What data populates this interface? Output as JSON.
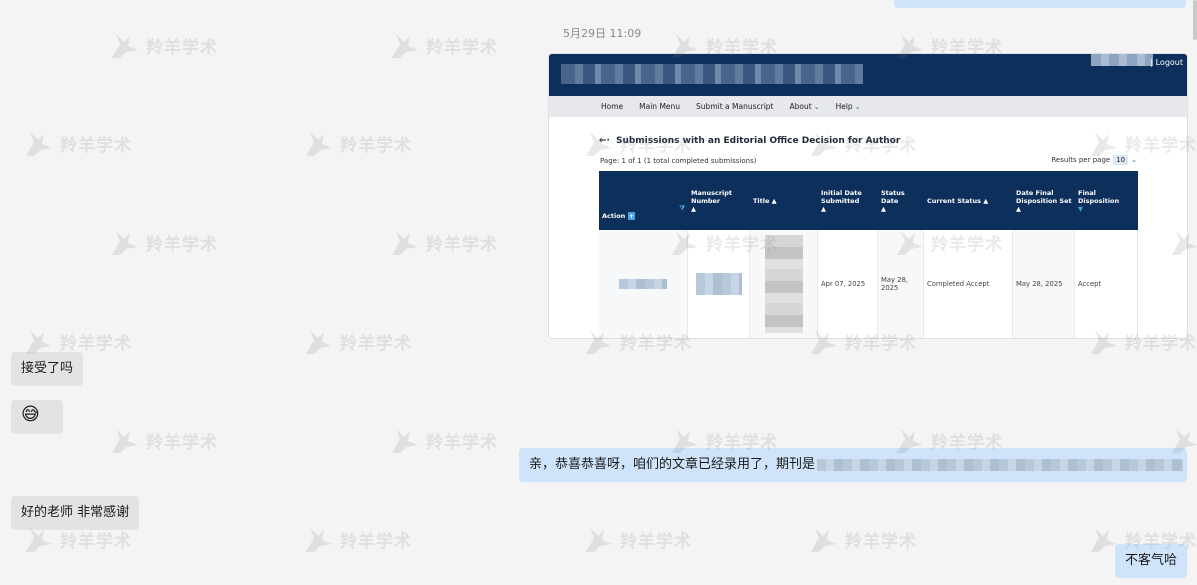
{
  "chat": {
    "timestamp": "5月29日 11:09",
    "messages": [
      {
        "side": "in",
        "text": "接受了吗"
      },
      {
        "side": "in",
        "emoji": "😅"
      },
      {
        "side": "out",
        "text": "亲，恭喜恭喜呀，咱们的文章已经录用了，期刊是"
      },
      {
        "side": "in",
        "text": "好的老师  非常感谢"
      },
      {
        "side": "out",
        "text": "不客气哈"
      }
    ]
  },
  "watermark": {
    "text": "羚羊学术"
  },
  "screenshot": {
    "logout": "Logout",
    "nav": [
      "Home",
      "Main Menu",
      "Submit a Manuscript",
      "About",
      "Help"
    ],
    "title": "Submissions with an Editorial Office Decision for Author",
    "page_info": "Page: 1 of 1 (1 total completed submissions)",
    "results_per_page_label": "Results per page",
    "results_per_page_value": "10",
    "columns": [
      "Action",
      "Manuscript Number",
      "Title",
      "Initial Date Submitted",
      "Status Date",
      "Current Status",
      "Date Final Disposition Set",
      "Final Disposition"
    ],
    "row": {
      "initial_date_submitted": "Apr 07, 2025",
      "status_date": "May 28, 2025",
      "current_status": "Completed Accept",
      "date_final_disposition_set": "May 28, 2025",
      "final_disposition": "Accept"
    }
  },
  "colors": {
    "header_navy": "#0c2f5b",
    "outgoing_bubble": "#cfe4fa",
    "incoming_bubble": "#e3e3e3",
    "page_bg": "#f4f4f4"
  }
}
